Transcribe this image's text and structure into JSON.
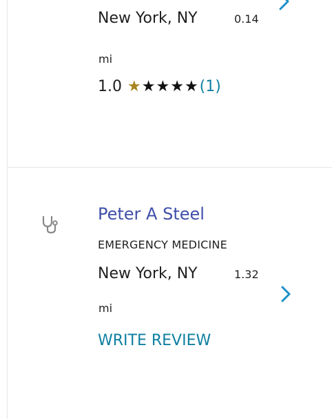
{
  "result_1": {
    "city": "New York, NY",
    "distance_value": "0.14",
    "distance_unit": "mi",
    "rating_score": "1.0",
    "rating_value": 1,
    "rating_max": 5,
    "review_count": "(1)",
    "colors": {
      "filled_star": "#a8841f",
      "empty_star": "#111111",
      "link": "#0e7fa1"
    }
  },
  "result_2": {
    "icon": "stethoscope-icon",
    "name": "Peter A Steel",
    "specialty": "EMERGENCY MEDICINE",
    "city": "New York, NY",
    "distance_value": "1.32",
    "distance_unit": "mi",
    "write_review_label": "WRITE REVIEW",
    "colors": {
      "name_link": "#3f4fa8",
      "action_link": "#0e7fa1",
      "chevron": "#1a8fc7"
    }
  }
}
